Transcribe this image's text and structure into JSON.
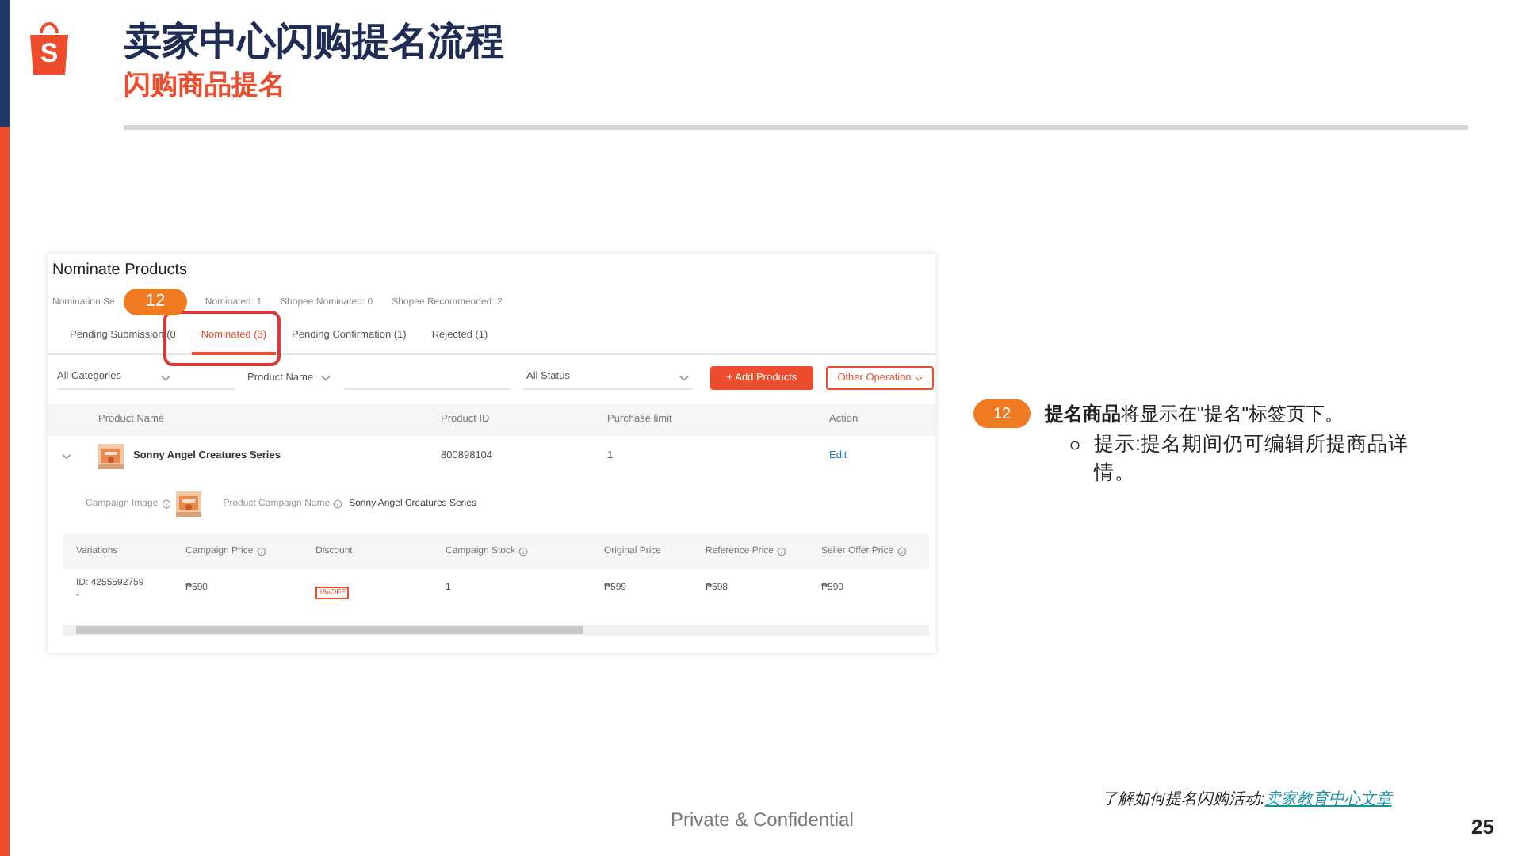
{
  "logo": {
    "letter": "S"
  },
  "title": "卖家中心闪购提名流程",
  "subtitle": "闪购商品提名",
  "screenshot": {
    "heading": "Nominate Products",
    "stats": [
      "Nomination Se",
      "Nominated: 1",
      "Shopee Nominated: 0",
      "Shopee Recommended: 2"
    ],
    "step_badge": "12",
    "tabs": [
      {
        "label": "Pending Submission (0",
        "selected": false
      },
      {
        "label": "Nominated (3)",
        "selected": true
      },
      {
        "label": "Pending Confirmation (1)",
        "selected": false
      },
      {
        "label": "Rejected (1)",
        "selected": false
      }
    ],
    "filters": {
      "category": "All Categories",
      "search_by": "Product Name",
      "status": "All Status"
    },
    "buttons": {
      "add": "+ Add Products",
      "other": "Other Operation"
    },
    "columns": [
      "Product Name",
      "Product ID",
      "Purchase limit",
      "Action"
    ],
    "product": {
      "expanded": true,
      "name": "Sonny Angel Creatures Series",
      "id": "800898104",
      "limit": "1",
      "action": "Edit",
      "campaign_image_label": "Campaign Image",
      "campaign_name_label": "Product Campaign Name",
      "campaign_name": "Sonny Angel Creatures Series"
    },
    "variation_columns": [
      {
        "label": "Variations",
        "info": false
      },
      {
        "label": "Campaign Price",
        "info": true
      },
      {
        "label": "Discount",
        "info": false
      },
      {
        "label": "Campaign Stock",
        "info": true
      },
      {
        "label": "Original Price",
        "info": false
      },
      {
        "label": "Reference Price",
        "info": true
      },
      {
        "label": "Seller Offer Price",
        "info": true
      }
    ],
    "variations": [
      {
        "id": "ID: 4255592759",
        "mark": "-",
        "campaign_price": "₱590",
        "discount": "1%OFF",
        "stock": "1",
        "original_price": "₱599",
        "reference_price": "₱598",
        "seller_offer_price": "₱590"
      }
    ]
  },
  "note": {
    "badge": "12",
    "text": "**提名商品**将显示在\"提名\"标签页下。",
    "bullets": [
      "提示:提名期间仍可编辑所提商品详情。"
    ]
  },
  "footer": {
    "confidential": "Private & Confidential",
    "link_prefix": "了解如何提名闪购活动:",
    "link": "卖家教育中心文章",
    "page": "25"
  }
}
